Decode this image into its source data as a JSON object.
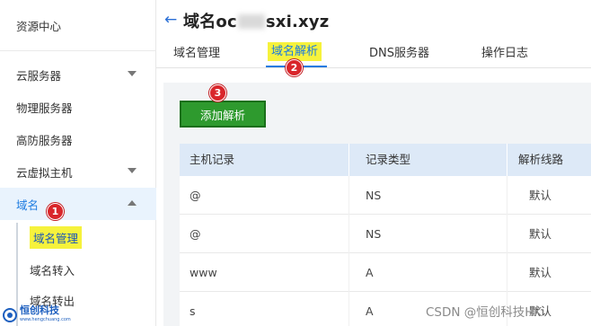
{
  "sidebar": {
    "items": [
      {
        "label": "资源中心"
      },
      {
        "label": "云服务器"
      },
      {
        "label": "物理服务器"
      },
      {
        "label": "高防服务器"
      },
      {
        "label": "云虚拟主机"
      },
      {
        "label": "域名"
      }
    ],
    "sub_items": [
      {
        "label": "域名管理"
      },
      {
        "label": "域名转入"
      },
      {
        "label": "域名转出"
      }
    ]
  },
  "header": {
    "back_icon": "arrow-left-icon",
    "title_prefix": "域名oc",
    "title_suffix": "sxi.xyz"
  },
  "tabs": [
    {
      "label": "域名管理"
    },
    {
      "label": "域名解析"
    },
    {
      "label": "DNS服务器"
    },
    {
      "label": "操作日志"
    }
  ],
  "actions": {
    "add_label": "添加解析"
  },
  "table": {
    "columns": [
      "主机记录",
      "记录类型",
      "解析线路"
    ],
    "rows": [
      [
        "@",
        "NS",
        "默认"
      ],
      [
        "@",
        "NS",
        "默认"
      ],
      [
        "www",
        "A",
        "默认"
      ],
      [
        "s",
        "A",
        "默认"
      ]
    ]
  },
  "steps": [
    "1",
    "2",
    "3"
  ],
  "watermark": {
    "logo_text": "恒创科技",
    "logo_sub": "www.hengchuang.com",
    "csdn": "CSDN @恒创科技HK"
  },
  "colors": {
    "accent": "#1c7be0",
    "highlight": "#f6f23c",
    "add_button": "#2e9a2e",
    "step_marker": "#d9262b",
    "table_header": "#dde9f7"
  }
}
